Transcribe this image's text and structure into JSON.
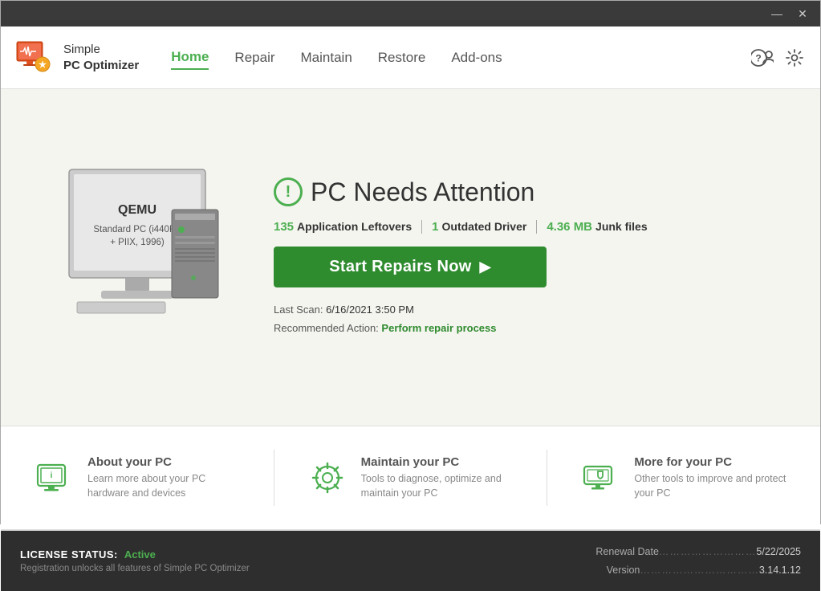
{
  "titlebar": {
    "minimize_label": "—",
    "close_label": "✕"
  },
  "header": {
    "logo_line1": "Simple",
    "logo_line2": "PC Optimizer",
    "nav_items": [
      {
        "id": "home",
        "label": "Home",
        "active": true
      },
      {
        "id": "repair",
        "label": "Repair",
        "active": false
      },
      {
        "id": "maintain",
        "label": "Maintain",
        "active": false
      },
      {
        "id": "restore",
        "label": "Restore",
        "active": false
      },
      {
        "id": "addons",
        "label": "Add-ons",
        "active": false
      }
    ]
  },
  "main": {
    "pc_name": "QEMU",
    "pc_model": "Standard PC (i440FX + PIIX, 1996)",
    "attention_title": "PC Needs Attention",
    "stats": [
      {
        "num": "135",
        "label": "Application Leftovers"
      },
      {
        "num": "1",
        "label": "Outdated Driver"
      },
      {
        "num": "4.36 MB",
        "label": "Junk files"
      }
    ],
    "repair_btn_label": "Start Repairs Now",
    "repair_btn_arrow": "▶",
    "last_scan_label": "Last Scan:",
    "last_scan_value": "6/16/2021 3:50 PM",
    "recommended_label": "Recommended Action:",
    "recommended_action": "Perform repair process"
  },
  "cards": [
    {
      "id": "about-pc",
      "title": "About your PC",
      "description": "Learn more about your PC hardware and devices"
    },
    {
      "id": "maintain-pc",
      "title": "Maintain your PC",
      "description": "Tools to diagnose, optimize and maintain your PC"
    },
    {
      "id": "more-pc",
      "title": "More for your PC",
      "description": "Other tools to improve and protect your PC"
    }
  ],
  "statusbar": {
    "license_label": "LICENSE STATUS:",
    "license_value": "Active",
    "license_desc": "Registration unlocks all features of Simple PC Optimizer",
    "renewal_label": "Renewal Date",
    "renewal_dots": "………………………",
    "renewal_value": "5/22/2025",
    "version_label": "Version",
    "version_dots": "……………………………",
    "version_value": "3.14.1.12"
  },
  "colors": {
    "green": "#2e8b2e",
    "light_green": "#4caf50"
  }
}
